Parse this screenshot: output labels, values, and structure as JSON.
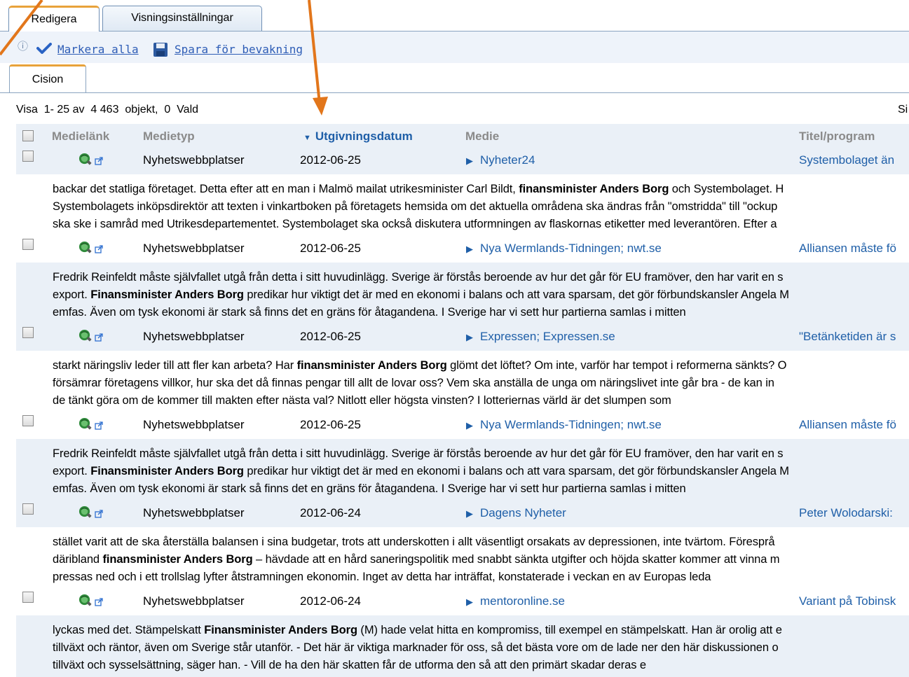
{
  "tabs": [
    {
      "label": "Redigera",
      "active": true
    },
    {
      "label": "Visningsinställningar",
      "active": false
    }
  ],
  "toolbar": {
    "mark_all": "Markera alla",
    "save_watch": "Spara för bevakning"
  },
  "subtab": {
    "label": "Cision"
  },
  "status": {
    "text": "Visa  1- 25 av  4 463  objekt,  0  Vald",
    "right": "Si"
  },
  "columns": {
    "medielank": "Medielänk",
    "medietyp": "Medietyp",
    "utgivningsdatum": "Utgivningsdatum",
    "medie": "Medie",
    "titel": "Titel/program"
  },
  "rows": [
    {
      "type": "Nyhetswebbplatser",
      "date": "2012-06-25",
      "media": "Nyheter24",
      "title": "Systembolaget än",
      "lines": [
        [
          "backar det statliga företaget. Detta efter att en man i Malmö mailat utrikesminister Carl Bildt, ",
          "finansminister Anders Borg",
          " och Systembolaget. H"
        ],
        [
          "Systembolagets inköpsdirektör att texten i vinkartboken på företagets hemsida om det aktuella områdena ska ändras från \"omstridda\" till \"ockup",
          "",
          ""
        ],
        [
          "ska ske i samråd med Utrikesdepartementet. Systembolaget ska också diskutera utformningen av flaskornas etiketter med leverantören. Efter a",
          "",
          ""
        ]
      ]
    },
    {
      "type": "Nyhetswebbplatser",
      "date": "2012-06-25",
      "media": "Nya Wermlands-Tidningen; nwt.se",
      "title": "Alliansen måste fö",
      "lines": [
        [
          "Fredrik Reinfeldt måste självfallet utgå från detta i sitt huvudinlägg. Sverige är förstås beroende av hur det går för EU framöver, den har varit en s",
          "",
          ""
        ],
        [
          "export. ",
          "Finansminister Anders Borg",
          " predikar hur viktigt det är med en ekonomi i balans och att vara sparsam, det gör förbundskansler Angela M"
        ],
        [
          "emfas. Även om tysk ekonomi är stark så finns det en gräns för åtagandena. I Sverige har vi sett hur partierna samlas i mitten",
          "",
          ""
        ]
      ]
    },
    {
      "type": "Nyhetswebbplatser",
      "date": "2012-06-25",
      "media": "Expressen; Expressen.se",
      "title": "\"Betänketiden är s",
      "lines": [
        [
          "starkt näringsliv leder till att fler kan arbeta? Har ",
          "finansminister Anders Borg",
          " glömt det löftet? Om inte, varför har tempot i reformerna sänkts? O"
        ],
        [
          "försämrar företagens villkor, hur ska det då finnas pengar till allt de lovar oss? Vem ska anställa de unga om näringslivet inte går bra - de kan in",
          "",
          ""
        ],
        [
          "de tänkt göra om de kommer till makten efter nästa val? Nitlott eller högsta vinsten? I lotteriernas värld är det slumpen som",
          "",
          ""
        ]
      ]
    },
    {
      "type": "Nyhetswebbplatser",
      "date": "2012-06-25",
      "media": "Nya Wermlands-Tidningen; nwt.se",
      "title": "Alliansen måste fö",
      "lines": [
        [
          "Fredrik Reinfeldt måste självfallet utgå från detta i sitt huvudinlägg. Sverige är förstås beroende av hur det går för EU framöver, den har varit en s",
          "",
          ""
        ],
        [
          "export. ",
          "Finansminister Anders Borg",
          " predikar hur viktigt det är med en ekonomi i balans och att vara sparsam, det gör förbundskansler Angela M"
        ],
        [
          "emfas. Även om tysk ekonomi är stark så finns det en gräns för åtagandena. I Sverige har vi sett hur partierna samlas i mitten",
          "",
          ""
        ]
      ]
    },
    {
      "type": "Nyhetswebbplatser",
      "date": "2012-06-24",
      "media": "Dagens Nyheter",
      "title": "Peter Wolodarski:",
      "lines": [
        [
          "stället varit att de ska återställa balansen i sina budgetar, trots att underskotten i allt väsentligt orsakats av depressionen, inte tvärtom. Föresprå",
          "",
          ""
        ],
        [
          "däribland ",
          "finansminister Anders Borg",
          " – hävdade att en hård saneringspolitik med snabbt sänkta utgifter och höjda skatter kommer att vinna m"
        ],
        [
          "pressas ned och i ett trollslag lyfter åtstramningen ekonomin. Inget av detta har inträffat, konstaterade i veckan en av Europas leda",
          "",
          ""
        ]
      ]
    },
    {
      "type": "Nyhetswebbplatser",
      "date": "2012-06-24",
      "media": "mentoronline.se",
      "title": "Variant på Tobinsk",
      "lines": [
        [
          "lyckas med det. Stämpelskatt ",
          "Finansminister Anders Borg",
          " (M) hade velat hitta en kompromiss, till exempel en stämpelskatt. Han är orolig att e"
        ],
        [
          "tillväxt och räntor, även om Sverige står utanför. - Det här är viktiga marknader för oss, så det bästa vore om de lade ner den här diskussionen o",
          "",
          ""
        ],
        [
          "tillväxt och sysselsättning, säger han. - Vill de ha den här skatten får de utforma den så att den primärt skadar deras e",
          "",
          ""
        ]
      ]
    }
  ],
  "colors": {
    "accent": "#e8a23a",
    "link": "#1f5fa8",
    "annotation": "#e2761b",
    "row_shade": "#eaf0f7"
  },
  "icons": {
    "info": "info-icon",
    "check": "checkmark-icon",
    "save": "floppy-disk-icon",
    "globe": "globe-search-icon",
    "external": "external-link-icon",
    "sort": "sort-descending-icon"
  }
}
